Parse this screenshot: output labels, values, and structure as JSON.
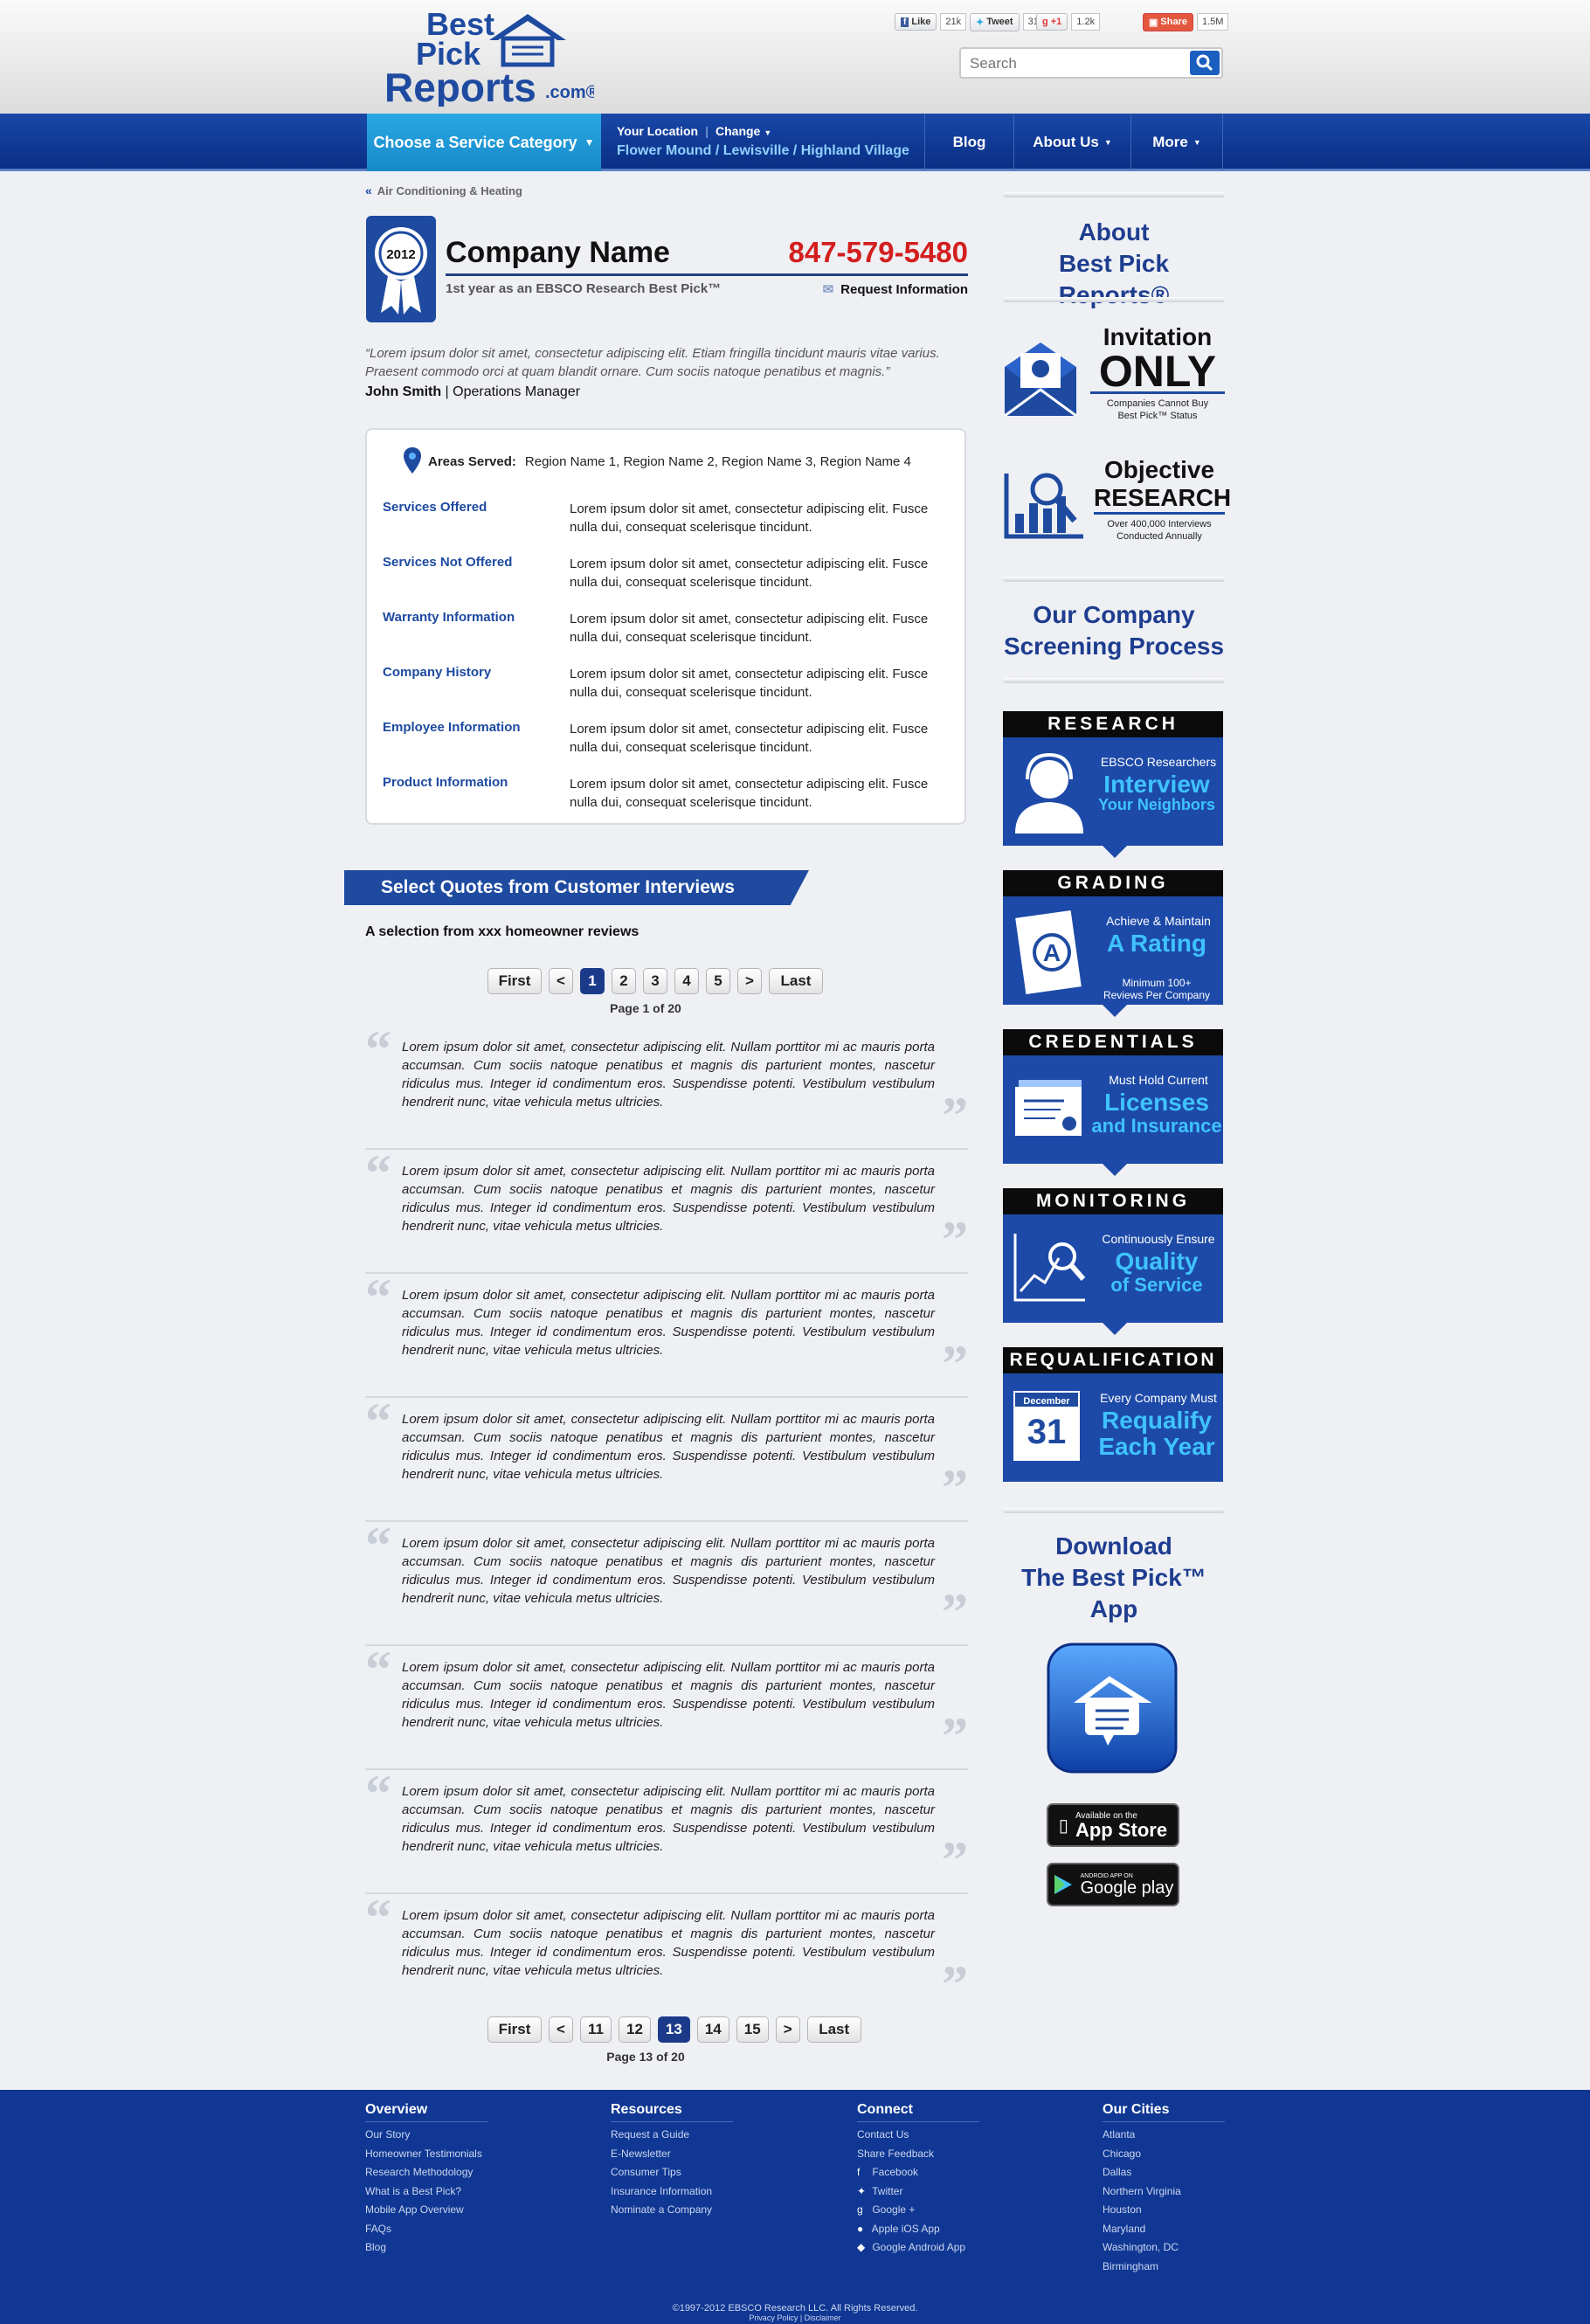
{
  "logo": {
    "line1": "Best",
    "line2": "Pick",
    "line3": "Reports",
    "suffix": ".com®"
  },
  "social": {
    "like": "Like",
    "like_count": "21k",
    "tweet": "Tweet",
    "tweet_count": "316",
    "gplus": "+1",
    "gplus_count": "1.2k",
    "share": "Share",
    "share_count": "1.5M"
  },
  "search": {
    "placeholder": "Search"
  },
  "nav": {
    "category": "Choose a Service Category",
    "loc_label": "Your Location",
    "change": "Change",
    "location": "Flower Mound / Lewisville / Highland Village",
    "blog": "Blog",
    "about": "About Us",
    "more": "More"
  },
  "breadcrumb": "Air Conditioning & Heating",
  "ribbon": {
    "year": "2012",
    "ring": "EBSCO RESEARCH · BEST PICK"
  },
  "company": {
    "name": "Company Name",
    "phone": "847-579-5480",
    "sub": "1st year as an EBSCO Research Best Pick™",
    "request": "Request Information"
  },
  "testimonial": {
    "text": "“Lorem ipsum dolor sit amet, consectetur adipiscing elit. Etiam fringilla tincidunt mauris vitae varius. Praesent commodo orci at quam blandit ornare. Cum sociis natoque penatibus et magnis.”",
    "author": "John Smith",
    "role": "Operations Manager"
  },
  "areas": {
    "label": "Areas Served:",
    "value": "Region Name 1, Region Name 2, Region Name 3, Region  Name 4"
  },
  "info": [
    {
      "k": "Services Offered",
      "v": "Lorem ipsum dolor sit amet, consectetur adipiscing elit. Fusce nulla dui, consequat scelerisque tincidunt."
    },
    {
      "k": "Services Not Offered",
      "v": "Lorem ipsum dolor sit amet, consectetur adipiscing elit. Fusce nulla dui, consequat scelerisque tincidunt."
    },
    {
      "k": "Warranty Information",
      "v": "Lorem ipsum dolor sit amet, consectetur adipiscing elit. Fusce nulla dui, consequat scelerisque tincidunt."
    },
    {
      "k": "Company History",
      "v": "Lorem ipsum dolor sit amet, consectetur adipiscing elit. Fusce nulla dui, consequat scelerisque tincidunt."
    },
    {
      "k": "Employee Information",
      "v": "Lorem ipsum dolor sit amet, consectetur adipiscing elit. Fusce nulla dui, consequat scelerisque tincidunt."
    },
    {
      "k": "Product Information",
      "v": "Lorem ipsum dolor sit amet, consectetur adipiscing elit. Fusce nulla dui, consequat scelerisque tincidunt."
    }
  ],
  "quotes": {
    "heading": "Select Quotes from Customer Interviews",
    "sub": "A selection from xxx homeowner reviews"
  },
  "pager1": {
    "first": "First",
    "prev": "<",
    "pages": [
      "1",
      "2",
      "3",
      "4",
      "5"
    ],
    "next": ">",
    "last": "Last",
    "info": "Page 1 of 20"
  },
  "pager2": {
    "first": "First",
    "prev": "<",
    "pages": [
      "11",
      "12",
      "13",
      "14",
      "15"
    ],
    "next": ">",
    "last": "Last",
    "info": "Page 13 of 20"
  },
  "review_text": "Lorem ipsum dolor sit amet, consectetur adipiscing elit. Nullam porttitor mi ac mauris porta accumsan. Cum sociis natoque penatibus et magnis dis parturient montes, nascetur ridiculus mus. Integer id condimentum eros. Suspendisse potenti. Vestibulum vestibulum hendrerit nunc, vitae vehicula metus ultricies.",
  "side": {
    "about1": "About",
    "about2": "Best Pick Reports®",
    "inv1": "Invitation",
    "inv2": "ONLY",
    "inv3": "Companies Cannot Buy Best Pick™ Status",
    "obj1": "Objective",
    "obj2": "RESEARCH",
    "obj3": "Over 400,000 Interviews Conducted Annually",
    "scr1": "Our Company",
    "scr2": "Screening Process",
    "tiles": [
      {
        "title": "RESEARCH",
        "s1": "EBSCO Researchers",
        "s2": "Interview",
        "s3": "Your Neighbors"
      },
      {
        "title": "GRADING",
        "s1": "Achieve & Maintain",
        "s2": "A Rating",
        "s3": "Minimum 100+ Reviews Per Company"
      },
      {
        "title": "CREDENTIALS",
        "s1": "Must Hold Current",
        "s2": "Licenses",
        "s3": "and Insurance"
      },
      {
        "title": "MONITORING",
        "s1": "Continuously Ensure",
        "s2": "Quality",
        "s3": "of Service"
      },
      {
        "title": "REQUALIFICATION",
        "s1": "Every Company Must",
        "s2": "Requalify",
        "s3": "Each Year"
      }
    ],
    "cal_month": "December",
    "cal_day": "31",
    "dl1": "Download",
    "dl2": "The Best Pick™ App",
    "appstore_small": "Available on the",
    "appstore": "App Store",
    "gplay_small": "ANDROID APP ON",
    "gplay": "Google play"
  },
  "footer": {
    "cols": [
      {
        "h": "Overview",
        "items": [
          "Our Story",
          "Homeowner Testimonials",
          "Research Methodology",
          "What is a Best Pick?",
          "Mobile App Overview",
          "FAQs",
          "Blog"
        ]
      },
      {
        "h": "Resources",
        "items": [
          "Request a Guide",
          "E-Newsletter",
          "Consumer Tips",
          "Insurance Information",
          "Nominate a Company"
        ]
      },
      {
        "h": "Connect",
        "items": [
          "Contact Us",
          "Share Feedback",
          "Facebook",
          "Twitter",
          "Google +",
          "Apple iOS App",
          "Google Android App"
        ]
      },
      {
        "h": "Our Cities",
        "items": [
          "Atlanta",
          "Chicago",
          "Dallas",
          "Northern Virginia",
          "Houston",
          "Maryland",
          "Washington, DC",
          "Birmingham"
        ]
      }
    ],
    "copyright": "©1997-2012 EBSCO Research LLC. All Rights Reserved.",
    "links": "Privacy Policy | Disclaimer"
  },
  "colors": {
    "brand": "#1e4aa0",
    "accent": "#2aa8e3",
    "phone": "#d41e1e",
    "footer": "#0f3793"
  }
}
